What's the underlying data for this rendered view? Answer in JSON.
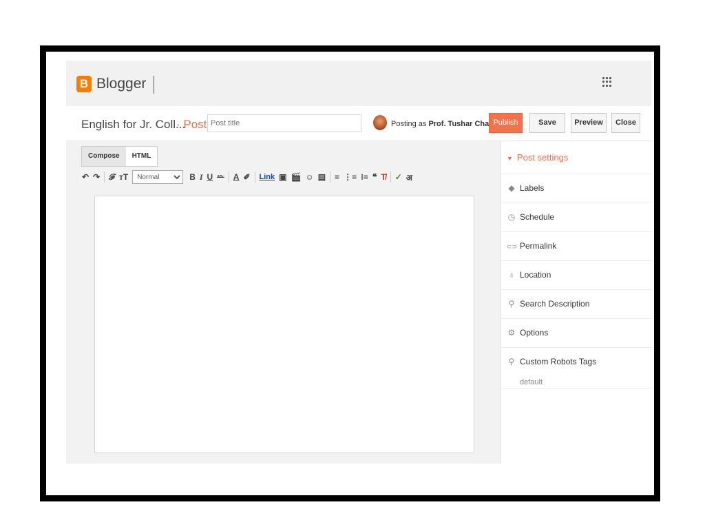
{
  "header": {
    "logo_letter": "B",
    "logo_text": "Blogger",
    "apps_icon": "apps-grid-icon"
  },
  "titlebar": {
    "blog_name": "English for Jr. Coll...",
    "crumb": "· Post",
    "post_title_placeholder": "Post title",
    "posting_as_prefix": "Posting as",
    "author": "Prof. Tushar Chavan",
    "buttons": {
      "publish": "Publish",
      "save": "Save",
      "preview": "Preview",
      "close": "Close"
    }
  },
  "editor": {
    "mode_tabs": [
      "Compose",
      "HTML"
    ],
    "active_mode": "Compose",
    "toolbar": {
      "undo": "↶",
      "redo": "↷",
      "font": "𝓕",
      "font_size": "тT",
      "format_value": "Normal",
      "bold": "B",
      "italic": "I",
      "underline": "U",
      "strike": "ᴬᴮᶜ",
      "text_color": "A",
      "highlight": "✐",
      "link": "Link",
      "image": "▣",
      "video": "🎬",
      "emoji": "☺",
      "jump_break": "▤",
      "align": "≡",
      "numbered_list": "⋮≡",
      "bullet_list": "⁝≡",
      "quote": "❝",
      "clear_format": "T̸",
      "spellcheck": "✓",
      "input_tools": "अ"
    }
  },
  "sidebar": {
    "title": "Post settings",
    "items": [
      {
        "icon": "label-tag-icon",
        "glyph": "◆",
        "label": "Labels"
      },
      {
        "icon": "clock-icon",
        "glyph": "◷",
        "label": "Schedule"
      },
      {
        "icon": "link-chain-icon",
        "glyph": "⊂⊃",
        "label": "Permalink"
      },
      {
        "icon": "location-pin-icon",
        "glyph": "♁",
        "label": "Location"
      },
      {
        "icon": "search-icon",
        "glyph": "⚲",
        "label": "Search Description"
      },
      {
        "icon": "gear-icon",
        "glyph": "⚙",
        "label": "Options"
      },
      {
        "icon": "search-icon",
        "glyph": "⚲",
        "label": "Custom Robots Tags"
      }
    ],
    "robots_value": "default"
  },
  "colors": {
    "accent": "#e8714b",
    "publish_bg": "#f0734f",
    "logo_orange": "#f57d00"
  }
}
